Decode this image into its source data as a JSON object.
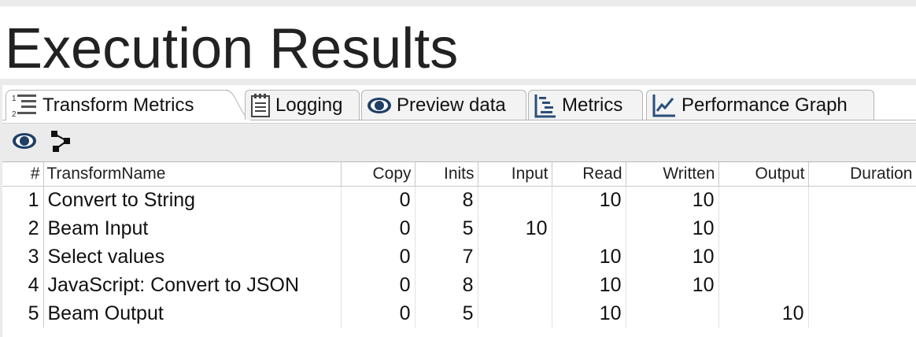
{
  "page": {
    "title": "Execution Results"
  },
  "tabs": [
    {
      "label": "Transform Metrics",
      "icon": "list-numbered-icon",
      "active": true
    },
    {
      "label": "Logging",
      "icon": "notepad-icon",
      "active": false
    },
    {
      "label": "Preview data",
      "icon": "eye-icon",
      "active": false
    },
    {
      "label": "Metrics",
      "icon": "gantt-icon",
      "active": false
    },
    {
      "label": "Performance Graph",
      "icon": "line-chart-icon",
      "active": false
    }
  ],
  "toolbar": {
    "buttons": [
      {
        "icon": "eye-icon"
      },
      {
        "icon": "pipeline-icon"
      }
    ]
  },
  "table": {
    "headers": [
      "#",
      "TransformName",
      "Copy",
      "Inits",
      "Input",
      "Read",
      "Written",
      "Output",
      "Duration"
    ],
    "rows": [
      [
        "1",
        "Convert to String",
        "0",
        "8",
        "",
        "10",
        "10",
        "",
        ""
      ],
      [
        "2",
        "Beam Input",
        "0",
        "5",
        "10",
        "",
        "10",
        "",
        ""
      ],
      [
        "3",
        "Select values",
        "0",
        "7",
        "",
        "10",
        "10",
        "",
        ""
      ],
      [
        "4",
        "JavaScript: Convert to JSON",
        "0",
        "8",
        "",
        "10",
        "10",
        "",
        ""
      ],
      [
        "5",
        "Beam Output",
        "0",
        "5",
        "",
        "10",
        "",
        "10",
        ""
      ]
    ]
  }
}
